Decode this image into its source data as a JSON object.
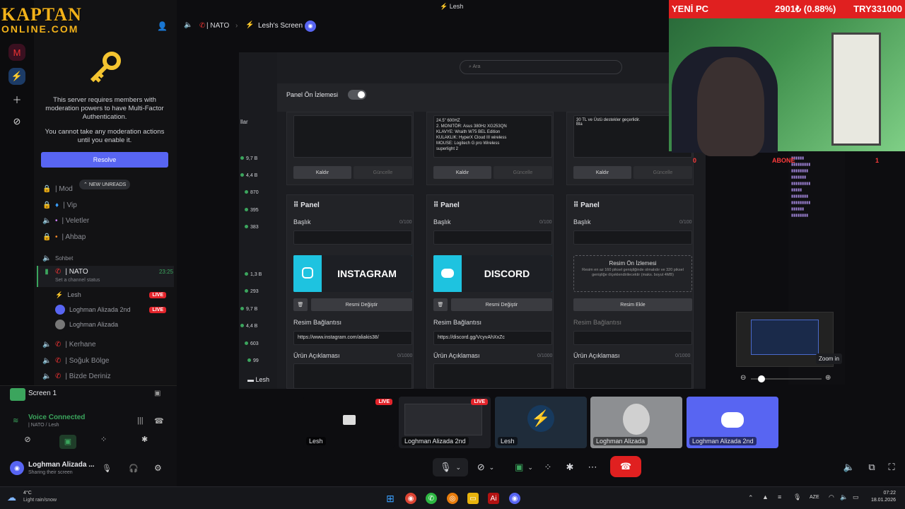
{
  "brand": {
    "line1": "KAPTAN",
    "line2": "ONLINE.COM"
  },
  "sidebar": {
    "mfa_message": "This server requires members with moderation powers to have Multi-Factor Authentication.",
    "mfa_warning": "You cannot take any moderation actions until you enable it.",
    "resolve_label": "Resolve",
    "new_unreads": "NEW UNREADS",
    "channels": [
      {
        "name": "| Mod"
      },
      {
        "name": "| Vip"
      },
      {
        "name": "| Veletler"
      },
      {
        "name": "| Ahbap"
      }
    ],
    "category": "Sohbet",
    "active_channel": {
      "name": "| NATO",
      "time": "23:25",
      "status": "Set a channel status"
    },
    "voice_users": [
      {
        "name": "Lesh",
        "live": "LIVE"
      },
      {
        "name": "Loghman Alizada 2nd",
        "live": "LIVE"
      },
      {
        "name": "Loghman Alizada",
        "live": ""
      }
    ],
    "more_channels": [
      {
        "name": "| Kerhane"
      },
      {
        "name": "| Soğuk Bölge"
      },
      {
        "name": "| Bizde Deriniz"
      }
    ]
  },
  "voice_panel": {
    "screen_label": "Screen 1",
    "status": "Voice Connected",
    "location": "| NATO / Lesh",
    "user_name": "Loghman Alizada ...",
    "user_status": "Sharing their screen"
  },
  "topbar": {
    "title": "Lesh"
  },
  "call_header": {
    "channel": "| NATO",
    "screen": "Lesh's Screen"
  },
  "stream": {
    "search_placeholder": "Ara",
    "preview_toggle_label": "Panel Ön İzlemesi",
    "side_label": "llar",
    "side_numbers": [
      "9,7 B",
      "4,4 B",
      "870",
      "395",
      "383",
      "1,3 B",
      "293",
      "9,7 B",
      "4,4 B",
      "603",
      "99"
    ],
    "top_cards": [
      {
        "text": "",
        "remove": "Kaldır",
        "update": "Güncelle"
      },
      {
        "text": "24.5\" 600HZ\n2. MONITÖR: Asus 380Hz XG253QN\nKLAVYE: Wraith W75 BEL Edition\nKULAKLIK: HyperX Cloud III wireless\nMOUSE: Logitech G pro Wireless\nsuperlight 2",
        "remove": "Kaldır",
        "update": "Güncelle"
      },
      {
        "text": "30 TL ve Üstü destekler geçerlidir.\nBla",
        "remove": "Kaldır",
        "update": "Güncelle"
      }
    ],
    "panels": [
      {
        "title": "Panel",
        "baslik": "Başlık",
        "count": "0/100",
        "image_text": "INSTAGRAM",
        "change": "Resmi Değiştir",
        "link_label": "Resim Bağlantısı",
        "link": "https://www.instagram.com/aliakis38/",
        "desc_label": "Ürün Açıklaması",
        "desc_count": "0/1000"
      },
      {
        "title": "Panel",
        "baslik": "Başlık",
        "count": "0/100",
        "image_text": "DISCORD",
        "change": "Resmi Değiştir",
        "link_label": "Resim Bağlantısı",
        "link": "https://discord.gg/VcyvAhXxZc",
        "desc_label": "Ürün Açıklaması",
        "desc_count": "0/1000"
      },
      {
        "title": "Panel",
        "baslik": "Başlık",
        "count": "0/100",
        "preview_title": "Resim Ön İzlemesi",
        "preview_text": "Resim en az 160 piksel genişliğinde olmalıdır ve 320 piksel genişliğe ölçeklendirilecektir (maks. boyut 4MB)",
        "add": "Resim Ekle",
        "link_label": "Resim Bağlantısı",
        "link": "",
        "desc_label": "Ürün Açıklaması",
        "desc_count": "0/1000"
      }
    ],
    "viewer_name": "Lesh",
    "zoom_tooltip": "Zoom in"
  },
  "webcam": {
    "left": "YENİ PC",
    "mid": "2901₺ (0.88%)",
    "right": "TRY331000",
    "score_left": "0",
    "abone": "ABONE",
    "score_right": "1"
  },
  "thumbnails": [
    {
      "label": "Lesh",
      "live": "LIVE"
    },
    {
      "label": "Loghman Alizada 2nd",
      "live": "LIVE"
    },
    {
      "label": "Lesh",
      "live": ""
    },
    {
      "label": "Loghman Alizada",
      "live": ""
    },
    {
      "label": "Loghman Alizada 2nd",
      "live": ""
    }
  ],
  "taskbar": {
    "weather_temp": "4°C",
    "weather_desc": "Light rain/snow",
    "lang": "AZE",
    "time": "07:22",
    "date": "18.01.2026"
  },
  "colors": {
    "accent": "#5865f2",
    "live": "#e3242b",
    "online": "#3ba55d",
    "end_call": "#e02020"
  }
}
